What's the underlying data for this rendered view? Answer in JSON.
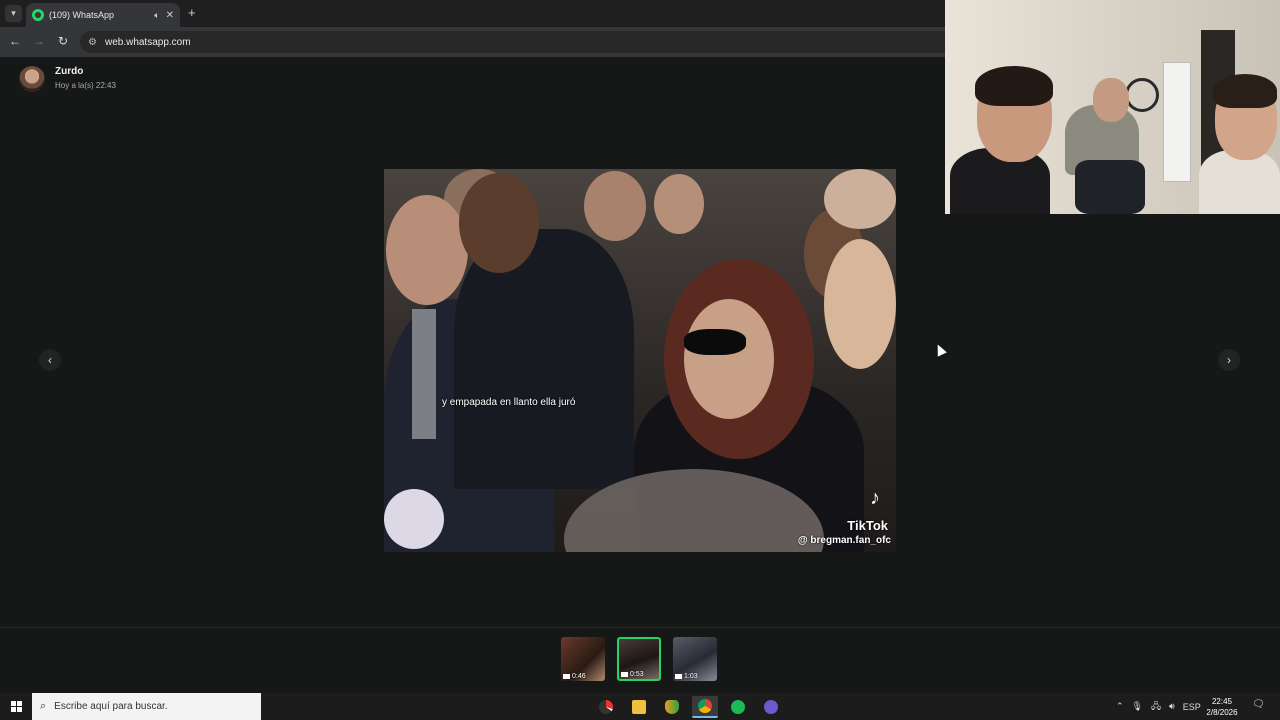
{
  "browser": {
    "tab_title": "(109) WhatsApp",
    "url": "web.whatsapp.com"
  },
  "viewer": {
    "sender_name": "Zurdo",
    "sender_time": "Hoy a la(s) 22:43",
    "caption": "y empapada en llanto ella juró",
    "watermark_brand": "TikTok",
    "watermark_handle": "@ bregman.fan_ofc",
    "prev_arrow": "‹",
    "next_arrow": "›"
  },
  "thumbnails": [
    {
      "duration": "0:46",
      "selected": false
    },
    {
      "duration": "0:53",
      "selected": true
    },
    {
      "duration": "1:03",
      "selected": false
    }
  ],
  "taskbar": {
    "search_placeholder": "Escribe aquí para buscar.",
    "language": "ESP",
    "time": "22:45",
    "date": "2/8/2026"
  },
  "colors": {
    "whatsapp_green": "#25d366",
    "viewer_bg": "#161717"
  },
  "icons": {
    "tab_menu": "chevron-down-icon",
    "speaker": "speaker-icon",
    "close": "close-icon",
    "new_tab": "plus-icon",
    "back": "back-arrow-icon",
    "forward": "forward-arrow-icon",
    "reload": "reload-icon",
    "site_info": "site-settings-icon",
    "start": "windows-logo-icon",
    "search": "search-icon"
  }
}
